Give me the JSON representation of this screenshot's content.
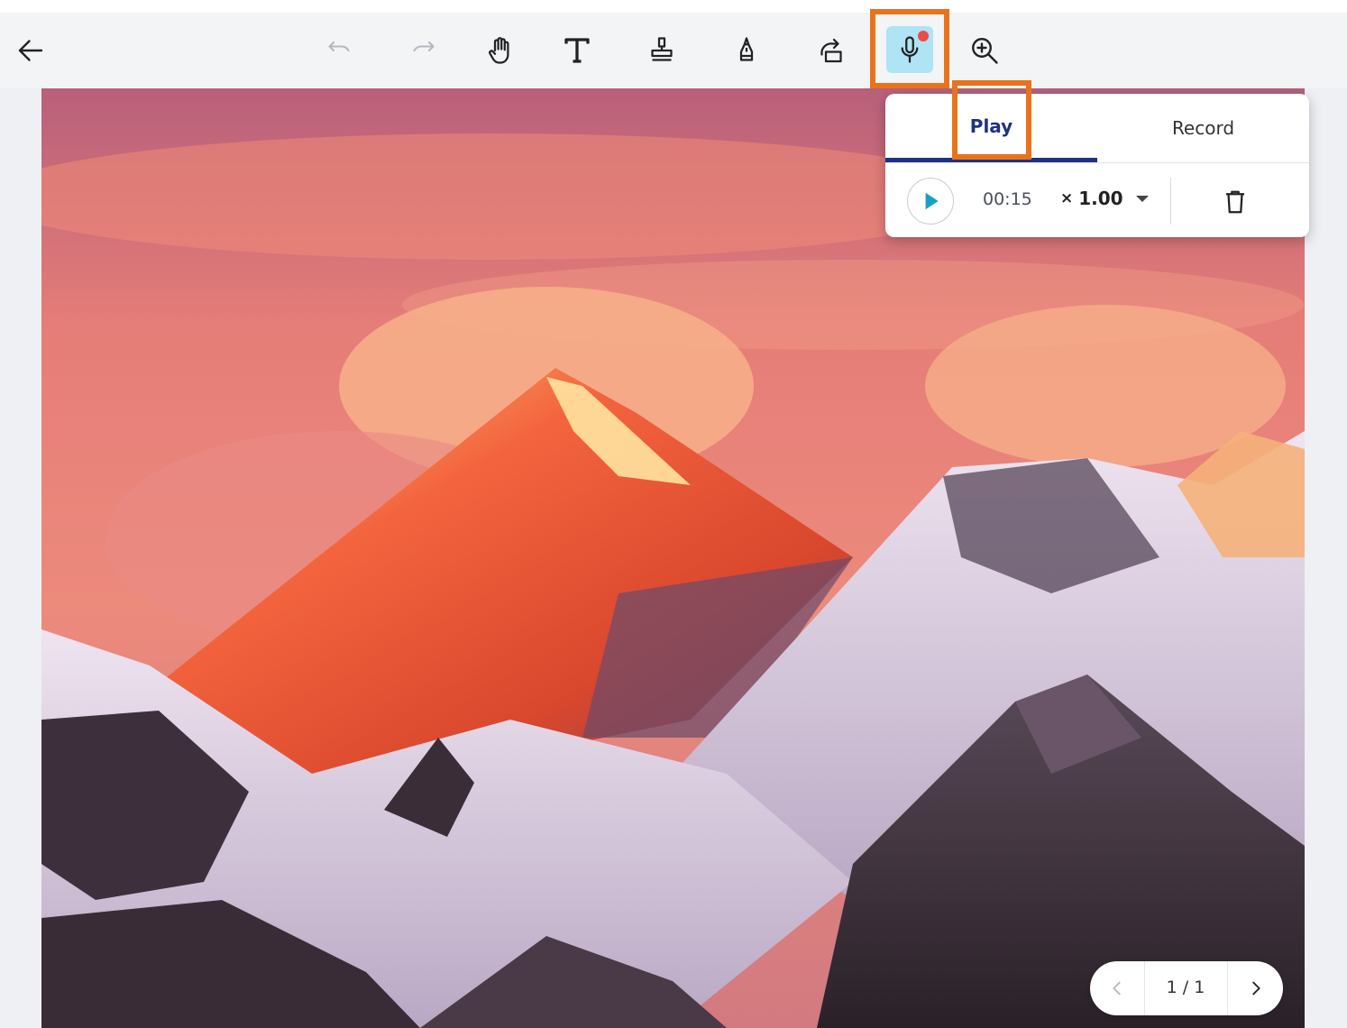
{
  "toolbar": {
    "items": [
      {
        "name": "back-arrow-icon"
      },
      {
        "name": "undo-icon"
      },
      {
        "name": "redo-icon"
      },
      {
        "name": "hand-pan-icon"
      },
      {
        "name": "text-tool-icon"
      },
      {
        "name": "stamp-icon"
      },
      {
        "name": "signature-pen-icon"
      },
      {
        "name": "share-export-icon"
      },
      {
        "name": "microphone-icon",
        "active": true,
        "recording_dot_color": "#ef4b4b",
        "active_bg": "#aee4f3"
      },
      {
        "name": "zoom-in-icon"
      }
    ]
  },
  "audio_popover": {
    "tabs": [
      {
        "label": "Play",
        "selected": true
      },
      {
        "label": "Record",
        "selected": false
      }
    ],
    "play_button_icon": "play-icon",
    "time": "00:15",
    "speed_prefix": "×",
    "speed_value": "1.00",
    "delete_icon": "trash-icon"
  },
  "pager": {
    "label": "1 / 1",
    "prev_icon": "chevron-left-icon",
    "next_icon": "chevron-right-icon"
  },
  "colors": {
    "accent_navy": "#1e3282",
    "highlight_orange": "#e8731c",
    "play_teal": "#1a9fc4"
  }
}
